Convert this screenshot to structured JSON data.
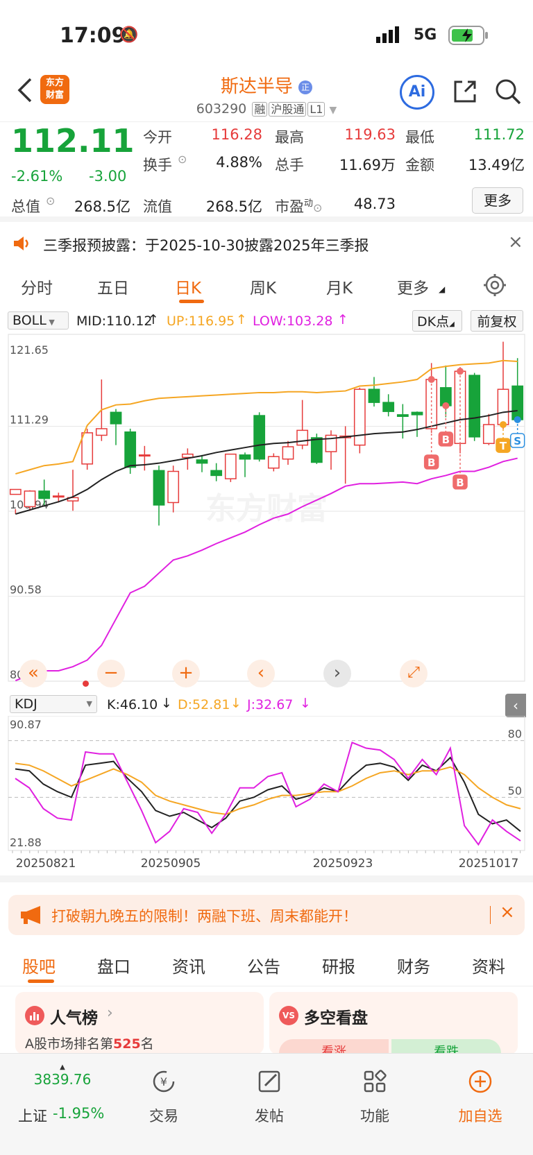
{
  "status": {
    "time": "17:09",
    "network": "5G"
  },
  "nav": {
    "logo": "东方财富",
    "name": "斯达半导",
    "code": "603290",
    "tags": [
      "融",
      "沪股通",
      "L1"
    ],
    "ai_label": "Ai"
  },
  "quote": {
    "price": "112.11",
    "change_pct": "-2.61%",
    "change": "-3.00",
    "open_label": "今开",
    "open": "116.28",
    "high_label": "最高",
    "high": "119.63",
    "low_label": "最低",
    "low": "111.72",
    "turnover_label": "换手",
    "turnover": "4.88%",
    "volume_label": "总手",
    "volume": "11.69万",
    "amount_label": "金额",
    "amount": "13.49亿",
    "mcap_label": "总值",
    "mcap": "268.5亿",
    "float_label": "流值",
    "float": "268.5亿",
    "pe_label": "市盈",
    "pe_sup": "动",
    "pe": "48.73",
    "more": "更多"
  },
  "notice": {
    "text": "三季报预披露：于2025-10-30披露2025年三季报"
  },
  "ktabs": [
    "分时",
    "五日",
    "日K",
    "周K",
    "月K",
    "更多"
  ],
  "ktabs_active": 2,
  "boll": {
    "name": "BOLL",
    "mid": "MID:110.12",
    "up": "UP:116.95",
    "low": "LOW:103.28",
    "dk": "DK点",
    "adjust": "前复权"
  },
  "kdj": {
    "name": "KDJ",
    "k": "K:46.10",
    "d": "D:52.81",
    "j": "J:32.67"
  },
  "colors": {
    "up": "#e63b3b",
    "down": "#17a33a",
    "mid": "#222222",
    "upper": "#f5a623",
    "lower": "#e020e0",
    "accent": "#f06a10"
  },
  "chart_data": [
    {
      "type": "candlestick",
      "title": "日K BOLL",
      "y_ticks": [
        "121.65",
        "111.29",
        "100.94",
        "90.58",
        "80.23"
      ],
      "ylim": [
        80.23,
        121.65
      ],
      "x_ticks": [
        "20250821",
        "20250905",
        "20250923",
        "20251017"
      ],
      "candles": [
        [
          103.0,
          103.6,
          101.2,
          100.6
        ],
        [
          101.5,
          103.4,
          103.5,
          101.0
        ],
        [
          103.4,
          102.5,
          104.8,
          101.6
        ],
        [
          102.8,
          102.8,
          103.2,
          102.0
        ],
        [
          102.2,
          102.6,
          106.0,
          101.0
        ],
        [
          106.7,
          110.5,
          111.0,
          106.0
        ],
        [
          110.2,
          111.0,
          117.0,
          109.5
        ],
        [
          113.0,
          111.6,
          113.4,
          109.0
        ],
        [
          110.6,
          106.3,
          111.0,
          105.5
        ],
        [
          107.8,
          107.8,
          108.9,
          105.9
        ],
        [
          105.9,
          101.7,
          106.5,
          99.2
        ],
        [
          102.0,
          105.8,
          106.5,
          100.8
        ],
        [
          107.5,
          107.9,
          108.6,
          106.0
        ],
        [
          107.2,
          106.8,
          107.8,
          105.7
        ],
        [
          105.9,
          105.3,
          106.8,
          104.6
        ],
        [
          104.9,
          107.9,
          107.9,
          104.5
        ],
        [
          107.8,
          107.3,
          108.1,
          105.1
        ],
        [
          112.6,
          107.3,
          113.0,
          107.0
        ],
        [
          106.2,
          107.6,
          108.0,
          105.8
        ],
        [
          107.3,
          108.8,
          109.5,
          106.6
        ],
        [
          109.0,
          110.8,
          114.5,
          108.5
        ],
        [
          109.9,
          106.9,
          110.4,
          106.7
        ],
        [
          108.2,
          110.2,
          110.8,
          106.0
        ],
        [
          109.9,
          110.1,
          111.3,
          104.3
        ],
        [
          109.0,
          115.8,
          116.0,
          108.0
        ],
        [
          115.8,
          114.2,
          117.3,
          113.7
        ],
        [
          114.2,
          113.1,
          115.2,
          112.5
        ],
        [
          112.7,
          112.5,
          114.0,
          109.8
        ],
        [
          113.0,
          112.7,
          113.1,
          110.0
        ],
        [
          111.0,
          117.0,
          119.0,
          110.5
        ],
        [
          116.0,
          113.8,
          118.7,
          112.4
        ],
        [
          109.2,
          118.0,
          118.5,
          108.0
        ],
        [
          117.5,
          110.0,
          117.8,
          109.5
        ],
        [
          109.2,
          111.5,
          112.8,
          109.0
        ],
        [
          111.5,
          115.8,
          121.6,
          111.0
        ],
        [
          116.2,
          112.1,
          119.6,
          111.7
        ]
      ],
      "series": [
        {
          "name": "MID",
          "values": [
            100.6,
            101.1,
            101.6,
            102.1,
            102.7,
            103.6,
            104.8,
            105.8,
            106.5,
            106.6,
            106.8,
            107.1,
            107.4,
            107.7,
            108.1,
            108.4,
            108.7,
            109.0,
            109.2,
            109.3,
            109.5,
            109.7,
            109.8,
            110.0,
            110.2,
            110.4,
            110.5,
            110.6,
            110.9,
            111.3,
            111.7,
            112.1,
            112.3,
            112.6,
            113.0,
            113.2
          ]
        },
        {
          "name": "UP",
          "values": [
            105.5,
            106.0,
            106.5,
            106.7,
            107.0,
            111.4,
            113.3,
            113.9,
            114.0,
            114.4,
            114.7,
            114.8,
            114.9,
            115.0,
            115.1,
            115.2,
            115.3,
            115.4,
            115.4,
            115.5,
            115.5,
            115.4,
            115.5,
            115.6,
            116.2,
            116.3,
            116.5,
            116.7,
            117.0,
            118.3,
            118.6,
            118.8,
            118.9,
            119.0,
            119.3,
            119.2
          ]
        },
        {
          "name": "LOW",
          "values": [
            80.3,
            81.0,
            81.5,
            81.5,
            82.0,
            82.8,
            84.6,
            87.8,
            91.0,
            91.8,
            93.4,
            95.0,
            95.5,
            96.2,
            97.0,
            97.7,
            98.4,
            99.3,
            100.1,
            100.6,
            101.5,
            102.3,
            103.1,
            104.0,
            104.3,
            104.3,
            104.4,
            104.5,
            104.3,
            104.9,
            105.3,
            105.8,
            105.8,
            106.3,
            107.0,
            107.4
          ]
        }
      ],
      "markers": [
        {
          "label": "B",
          "index": 29
        },
        {
          "label": "B",
          "index": 30
        },
        {
          "label": "B",
          "index": 31
        },
        {
          "label": "T",
          "index": 34
        },
        {
          "label": "S",
          "index": 35
        }
      ]
    },
    {
      "type": "line",
      "title": "KDJ",
      "y_ticks": [
        "90.87",
        "21.88"
      ],
      "ylim": [
        21.88,
        90.87
      ],
      "ref_lines": [
        "80",
        "50"
      ],
      "series": [
        {
          "name": "K",
          "values": [
            65,
            64,
            57,
            53,
            50,
            67,
            68,
            69,
            60,
            53,
            43,
            40,
            42,
            38,
            34,
            39,
            48,
            50,
            54,
            56,
            49,
            51,
            55,
            53,
            61,
            67,
            68,
            66,
            59,
            67,
            64,
            71,
            58,
            41,
            36,
            38,
            32
          ]
        },
        {
          "name": "D",
          "values": [
            68,
            67,
            64,
            60,
            56,
            59,
            62,
            65,
            62,
            58,
            51,
            48,
            46,
            44,
            42,
            41,
            44,
            46,
            49,
            51,
            51,
            52,
            53,
            53,
            56,
            60,
            63,
            64,
            62,
            64,
            64,
            66,
            62,
            55,
            50,
            46,
            44
          ]
        },
        {
          "name": "J",
          "values": [
            60,
            55,
            44,
            39,
            38,
            74,
            73,
            73,
            58,
            43,
            26,
            32,
            44,
            42,
            31,
            41,
            55,
            55,
            61,
            63,
            45,
            49,
            57,
            53,
            79,
            76,
            75,
            70,
            60,
            70,
            62,
            76,
            35,
            25,
            38,
            32,
            27
          ]
        }
      ]
    }
  ],
  "chart_controls": [
    "«",
    "−",
    "+",
    "‹",
    "›",
    "⤢"
  ],
  "promo": {
    "text": "打破朝九晚五的限制！两融下班、周末都能开！"
  },
  "bottom_tabs": [
    "股吧",
    "盘口",
    "资讯",
    "公告",
    "研报",
    "财务",
    "资料"
  ],
  "cards": {
    "left_title": "人气榜",
    "left_sub_prefix": "A股市场排名第",
    "left_rank": "525",
    "left_sub_suffix": "名",
    "right_title": "多空看盘",
    "right_up": "看涨",
    "right_down": "看跌"
  },
  "bottom_bar": {
    "index_value": "3839.76",
    "index_label": "上证",
    "index_change": "-1.95%",
    "trade": "交易",
    "post": "发帖",
    "func": "功能",
    "add": "加自选"
  }
}
